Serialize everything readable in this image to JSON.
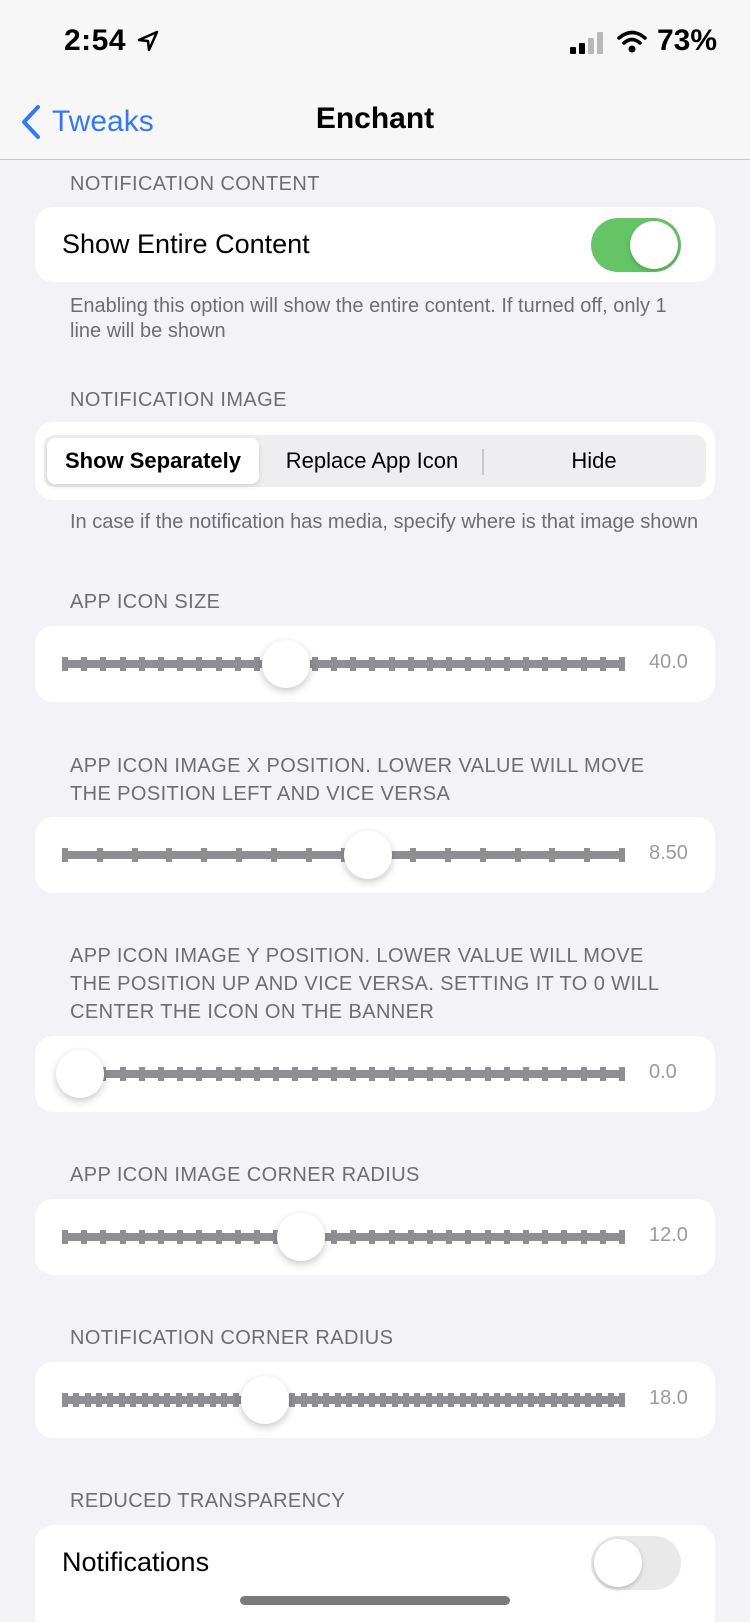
{
  "status_bar": {
    "time": "2:54",
    "battery": "73%"
  },
  "nav": {
    "back_label": "Tweaks",
    "title": "Enchant"
  },
  "notification_content": {
    "header": "NOTIFICATION CONTENT",
    "toggle_label": "Show Entire Content",
    "toggle_on": true,
    "footer": "Enabling this option will show the entire content. If turned off, only 1 line will be shown"
  },
  "notification_image": {
    "header": "NOTIFICATION IMAGE",
    "options": [
      "Show Separately",
      "Replace App Icon",
      "Hide"
    ],
    "selected": "Show Separately",
    "footer": "In case if the notification has media, specify where is that image shown"
  },
  "sliders": [
    {
      "header": "APP ICON SIZE",
      "value": "40.0",
      "fraction": 0.4
    },
    {
      "header": "APP ICON IMAGE X POSITION. LOWER VALUE WILL MOVE THE POSITION LEFT AND VICE VERSA",
      "value": "8.50",
      "fraction": 0.56
    },
    {
      "header": "APP ICON IMAGE Y POSITION. LOWER VALUE WILL MOVE THE POSITION UP AND VICE VERSA. SETTING IT TO 0 WILL CENTER THE ICON ON THE BANNER",
      "value": "0.0",
      "fraction": 0.0
    },
    {
      "header": "APP ICON IMAGE CORNER RADIUS",
      "value": "12.0",
      "fraction": 0.43
    },
    {
      "header": "NOTIFICATION CORNER RADIUS",
      "value": "18.0",
      "fraction": 0.36
    }
  ],
  "reduced_transparency": {
    "header": "REDUCED TRANSPARENCY",
    "items": [
      {
        "label": "Notifications",
        "on": false
      }
    ]
  },
  "colors": {
    "accent": "#3478f6",
    "toggle_on": "#65c466",
    "background": "#f2f2f7"
  }
}
